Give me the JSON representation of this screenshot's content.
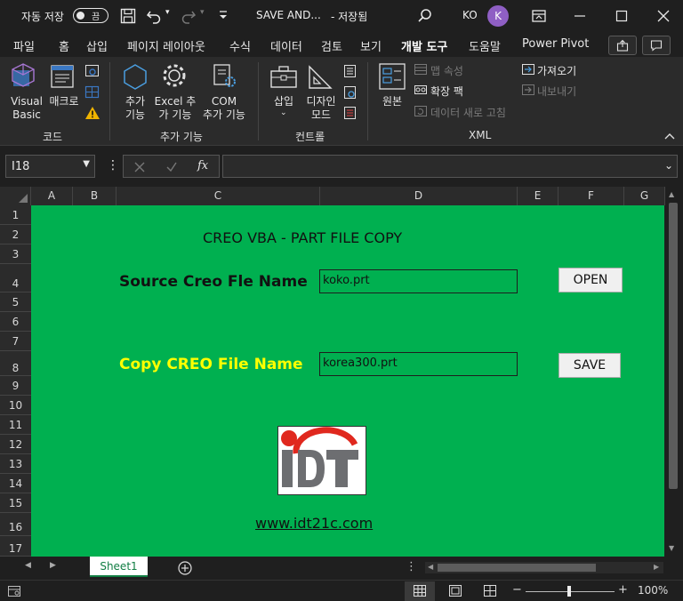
{
  "titlebar": {
    "autosave_label": "자동 저장",
    "autosave_state": "끔",
    "doc_title": "SAVE AND...",
    "save_status": "- 저장됨",
    "user_initials_text": "KO",
    "avatar_letter": "K"
  },
  "tabs": [
    "파일",
    "홈",
    "삽입",
    "페이지 레이아웃",
    "수식",
    "데이터",
    "검토",
    "보기",
    "개발 도구",
    "도움말",
    "Power Pivot"
  ],
  "active_tab": "개발 도구",
  "ribbon": {
    "code": {
      "label": "코드",
      "visual_basic": "Visual\nBasic",
      "macro": "매크로"
    },
    "addins": {
      "label": "추가 기능",
      "addins_btn": "추가\n기능",
      "excel_addins": "Excel 추\n가 기능",
      "com_addins": "COM\n추가 기능"
    },
    "controls": {
      "label": "컨트롤",
      "insert": "삽입",
      "design_mode": "디자인\n모드"
    },
    "xml": {
      "label": "XML",
      "source": "원본",
      "map_properties": "맵 속성",
      "expansion_packs": "확장 팩",
      "refresh_data": "데이터 새로 고침",
      "import": "가져오기",
      "export": "내보내기"
    }
  },
  "formula_bar": {
    "name_box": "I18",
    "fx": "fx",
    "formula": ""
  },
  "columns": [
    "A",
    "B",
    "C",
    "D",
    "E",
    "F",
    "G"
  ],
  "rows": [
    "1",
    "2",
    "3",
    "4",
    "5",
    "6",
    "7",
    "8",
    "9",
    "10",
    "11",
    "12",
    "13",
    "14",
    "15",
    "16",
    "17"
  ],
  "sheet": {
    "title": "CREO VBA - PART FILE COPY",
    "source_label": "Source Creo Fle Name",
    "source_value": "koko.prt",
    "open_button": "OPEN",
    "copy_label": "Copy CREO File Name",
    "copy_value": "korea300.prt",
    "save_button": "SAVE",
    "website": "www.idt21c.com",
    "logo_text": "IDT",
    "colors": {
      "background": "#00B050",
      "copy_label": "#FFFF00",
      "logo_red": "#E0281E",
      "logo_gray": "#6D6E71"
    }
  },
  "sheet_tabs": [
    "Sheet1"
  ],
  "status": {
    "zoom": "100%"
  }
}
